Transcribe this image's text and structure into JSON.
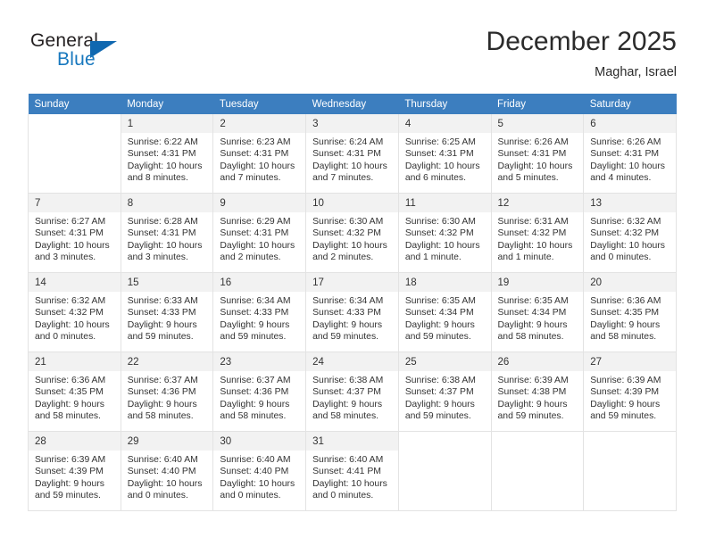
{
  "brand": {
    "word1": "General",
    "word2": "Blue",
    "accent_color": "#1068b0",
    "logo_icon": "triangle-logo-icon"
  },
  "header": {
    "title": "December 2025",
    "subtitle": "Maghar, Israel"
  },
  "theme": {
    "header_row_bg": "#3c7ebf",
    "daynum_bg": "#f2f2f2",
    "grid_line": "#e3e3e3",
    "text": "#333333"
  },
  "weekday_headers": [
    "Sunday",
    "Monday",
    "Tuesday",
    "Wednesday",
    "Thursday",
    "Friday",
    "Saturday"
  ],
  "weeks": [
    [
      {
        "day": "",
        "sunrise": "",
        "sunset": "",
        "daylight_a": "",
        "daylight_b": ""
      },
      {
        "day": "1",
        "sunrise": "Sunrise: 6:22 AM",
        "sunset": "Sunset: 4:31 PM",
        "daylight_a": "Daylight: 10 hours",
        "daylight_b": "and 8 minutes."
      },
      {
        "day": "2",
        "sunrise": "Sunrise: 6:23 AM",
        "sunset": "Sunset: 4:31 PM",
        "daylight_a": "Daylight: 10 hours",
        "daylight_b": "and 7 minutes."
      },
      {
        "day": "3",
        "sunrise": "Sunrise: 6:24 AM",
        "sunset": "Sunset: 4:31 PM",
        "daylight_a": "Daylight: 10 hours",
        "daylight_b": "and 7 minutes."
      },
      {
        "day": "4",
        "sunrise": "Sunrise: 6:25 AM",
        "sunset": "Sunset: 4:31 PM",
        "daylight_a": "Daylight: 10 hours",
        "daylight_b": "and 6 minutes."
      },
      {
        "day": "5",
        "sunrise": "Sunrise: 6:26 AM",
        "sunset": "Sunset: 4:31 PM",
        "daylight_a": "Daylight: 10 hours",
        "daylight_b": "and 5 minutes."
      },
      {
        "day": "6",
        "sunrise": "Sunrise: 6:26 AM",
        "sunset": "Sunset: 4:31 PM",
        "daylight_a": "Daylight: 10 hours",
        "daylight_b": "and 4 minutes."
      }
    ],
    [
      {
        "day": "7",
        "sunrise": "Sunrise: 6:27 AM",
        "sunset": "Sunset: 4:31 PM",
        "daylight_a": "Daylight: 10 hours",
        "daylight_b": "and 3 minutes."
      },
      {
        "day": "8",
        "sunrise": "Sunrise: 6:28 AM",
        "sunset": "Sunset: 4:31 PM",
        "daylight_a": "Daylight: 10 hours",
        "daylight_b": "and 3 minutes."
      },
      {
        "day": "9",
        "sunrise": "Sunrise: 6:29 AM",
        "sunset": "Sunset: 4:31 PM",
        "daylight_a": "Daylight: 10 hours",
        "daylight_b": "and 2 minutes."
      },
      {
        "day": "10",
        "sunrise": "Sunrise: 6:30 AM",
        "sunset": "Sunset: 4:32 PM",
        "daylight_a": "Daylight: 10 hours",
        "daylight_b": "and 2 minutes."
      },
      {
        "day": "11",
        "sunrise": "Sunrise: 6:30 AM",
        "sunset": "Sunset: 4:32 PM",
        "daylight_a": "Daylight: 10 hours",
        "daylight_b": "and 1 minute."
      },
      {
        "day": "12",
        "sunrise": "Sunrise: 6:31 AM",
        "sunset": "Sunset: 4:32 PM",
        "daylight_a": "Daylight: 10 hours",
        "daylight_b": "and 1 minute."
      },
      {
        "day": "13",
        "sunrise": "Sunrise: 6:32 AM",
        "sunset": "Sunset: 4:32 PM",
        "daylight_a": "Daylight: 10 hours",
        "daylight_b": "and 0 minutes."
      }
    ],
    [
      {
        "day": "14",
        "sunrise": "Sunrise: 6:32 AM",
        "sunset": "Sunset: 4:32 PM",
        "daylight_a": "Daylight: 10 hours",
        "daylight_b": "and 0 minutes."
      },
      {
        "day": "15",
        "sunrise": "Sunrise: 6:33 AM",
        "sunset": "Sunset: 4:33 PM",
        "daylight_a": "Daylight: 9 hours",
        "daylight_b": "and 59 minutes."
      },
      {
        "day": "16",
        "sunrise": "Sunrise: 6:34 AM",
        "sunset": "Sunset: 4:33 PM",
        "daylight_a": "Daylight: 9 hours",
        "daylight_b": "and 59 minutes."
      },
      {
        "day": "17",
        "sunrise": "Sunrise: 6:34 AM",
        "sunset": "Sunset: 4:33 PM",
        "daylight_a": "Daylight: 9 hours",
        "daylight_b": "and 59 minutes."
      },
      {
        "day": "18",
        "sunrise": "Sunrise: 6:35 AM",
        "sunset": "Sunset: 4:34 PM",
        "daylight_a": "Daylight: 9 hours",
        "daylight_b": "and 59 minutes."
      },
      {
        "day": "19",
        "sunrise": "Sunrise: 6:35 AM",
        "sunset": "Sunset: 4:34 PM",
        "daylight_a": "Daylight: 9 hours",
        "daylight_b": "and 58 minutes."
      },
      {
        "day": "20",
        "sunrise": "Sunrise: 6:36 AM",
        "sunset": "Sunset: 4:35 PM",
        "daylight_a": "Daylight: 9 hours",
        "daylight_b": "and 58 minutes."
      }
    ],
    [
      {
        "day": "21",
        "sunrise": "Sunrise: 6:36 AM",
        "sunset": "Sunset: 4:35 PM",
        "daylight_a": "Daylight: 9 hours",
        "daylight_b": "and 58 minutes."
      },
      {
        "day": "22",
        "sunrise": "Sunrise: 6:37 AM",
        "sunset": "Sunset: 4:36 PM",
        "daylight_a": "Daylight: 9 hours",
        "daylight_b": "and 58 minutes."
      },
      {
        "day": "23",
        "sunrise": "Sunrise: 6:37 AM",
        "sunset": "Sunset: 4:36 PM",
        "daylight_a": "Daylight: 9 hours",
        "daylight_b": "and 58 minutes."
      },
      {
        "day": "24",
        "sunrise": "Sunrise: 6:38 AM",
        "sunset": "Sunset: 4:37 PM",
        "daylight_a": "Daylight: 9 hours",
        "daylight_b": "and 58 minutes."
      },
      {
        "day": "25",
        "sunrise": "Sunrise: 6:38 AM",
        "sunset": "Sunset: 4:37 PM",
        "daylight_a": "Daylight: 9 hours",
        "daylight_b": "and 59 minutes."
      },
      {
        "day": "26",
        "sunrise": "Sunrise: 6:39 AM",
        "sunset": "Sunset: 4:38 PM",
        "daylight_a": "Daylight: 9 hours",
        "daylight_b": "and 59 minutes."
      },
      {
        "day": "27",
        "sunrise": "Sunrise: 6:39 AM",
        "sunset": "Sunset: 4:39 PM",
        "daylight_a": "Daylight: 9 hours",
        "daylight_b": "and 59 minutes."
      }
    ],
    [
      {
        "day": "28",
        "sunrise": "Sunrise: 6:39 AM",
        "sunset": "Sunset: 4:39 PM",
        "daylight_a": "Daylight: 9 hours",
        "daylight_b": "and 59 minutes."
      },
      {
        "day": "29",
        "sunrise": "Sunrise: 6:40 AM",
        "sunset": "Sunset: 4:40 PM",
        "daylight_a": "Daylight: 10 hours",
        "daylight_b": "and 0 minutes."
      },
      {
        "day": "30",
        "sunrise": "Sunrise: 6:40 AM",
        "sunset": "Sunset: 4:40 PM",
        "daylight_a": "Daylight: 10 hours",
        "daylight_b": "and 0 minutes."
      },
      {
        "day": "31",
        "sunrise": "Sunrise: 6:40 AM",
        "sunset": "Sunset: 4:41 PM",
        "daylight_a": "Daylight: 10 hours",
        "daylight_b": "and 0 minutes."
      },
      {
        "day": "",
        "sunrise": "",
        "sunset": "",
        "daylight_a": "",
        "daylight_b": ""
      },
      {
        "day": "",
        "sunrise": "",
        "sunset": "",
        "daylight_a": "",
        "daylight_b": ""
      },
      {
        "day": "",
        "sunrise": "",
        "sunset": "",
        "daylight_a": "",
        "daylight_b": ""
      }
    ]
  ]
}
